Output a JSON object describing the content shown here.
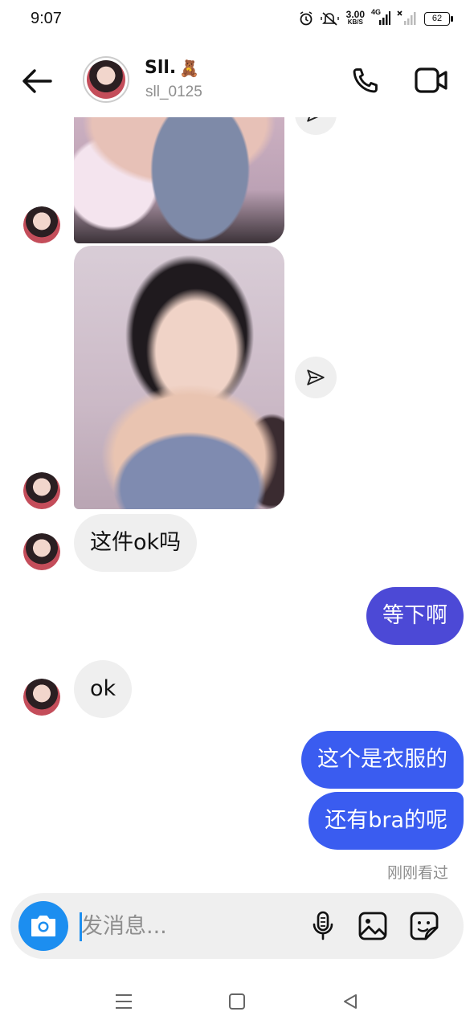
{
  "status_bar": {
    "time": "9:07",
    "net_speed_value": "3.00",
    "net_speed_unit": "KB/S",
    "network_type": "4G",
    "battery": "62"
  },
  "header": {
    "display_name": "Sll.",
    "name_emoji": "🧸",
    "username": "sll_0125"
  },
  "messages": [
    {
      "type": "photo",
      "from": "them"
    },
    {
      "type": "photo",
      "from": "them"
    },
    {
      "type": "text",
      "from": "them",
      "text": "这件ok吗"
    },
    {
      "type": "text",
      "from": "me",
      "text": "等下啊"
    },
    {
      "type": "text",
      "from": "them",
      "text": "ok"
    },
    {
      "type": "text",
      "from": "me",
      "text": "这个是衣服的"
    },
    {
      "type": "text",
      "from": "me",
      "text": "还有bra的呢"
    }
  ],
  "seen_status": "刚刚看过",
  "composer": {
    "placeholder": "发消息..."
  },
  "colors": {
    "outgoing_bubble": "#3a5cf0",
    "outgoing_bubble_first": "#4c49d6",
    "incoming_bubble": "#efefef",
    "camera_button": "#1c8ef0"
  }
}
